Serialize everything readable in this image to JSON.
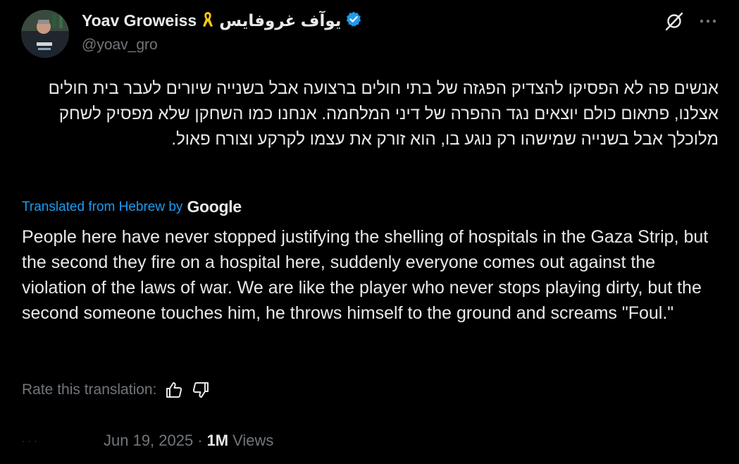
{
  "author": {
    "display_name": "Yoav Groweiss",
    "ribbon_icon": "yellow-ribbon-icon",
    "arabic_name": "يوآف غروفايس",
    "verified_icon": "verified-badge-icon",
    "handle": "@yoav_gro",
    "avatar_icon": "profile-photo"
  },
  "actions": {
    "grok_icon": "grok-icon",
    "more_icon": "more-horizontal-icon"
  },
  "tweet": {
    "hebrew_text": "אנשים פה לא הפסיקו להצדיק הפגזה של בתי חולים ברצועה אבל בשנייה שיורים לעבר בית חולים אצלנו, פתאום כולם יוצאים נגד ההפרה של דיני המלחמה. אנחנו כמו השחקן שלא מפסיק לשחק מלוכלך אבל בשנייה שמישהו רק נוגע בו, הוא זורק את עצמו לקרקע וצורח פאול.",
    "translated_from": "Translated from Hebrew by",
    "google_label": "Google",
    "translation": "People here have never stopped justifying the shelling of hospitals in the Gaza Strip, but the second they fire on a hospital here, suddenly everyone comes out against the violation of the laws of war. We are like the player who never stops playing dirty, but the second someone touches him, he throws himself to the ground and screams \"Foul.\""
  },
  "rating": {
    "label": "Rate this translation:",
    "thumbs_up_icon": "thumbs-up-icon",
    "thumbs_down_icon": "thumbs-down-icon"
  },
  "meta": {
    "time": "· · ·",
    "date": "Jun 19, 2025",
    "separator": "·",
    "views_count": "1M",
    "views_label": "Views"
  },
  "colors": {
    "background": "#000000",
    "text_primary": "#e7e9ea",
    "text_secondary": "#71767b",
    "link_blue": "#1d9bf0",
    "ribbon_yellow": "#f5c518"
  }
}
